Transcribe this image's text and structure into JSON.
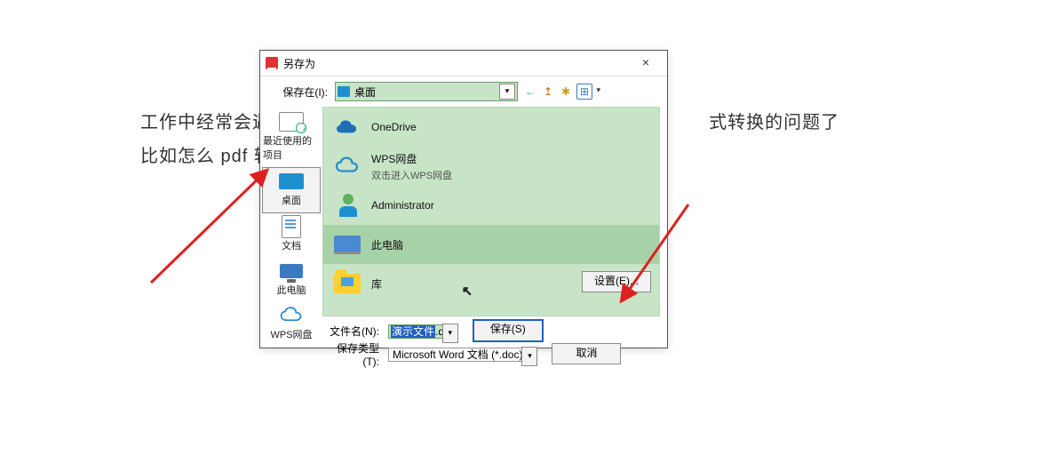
{
  "background": {
    "line1_left": "工作中经常会遇",
    "line1_right": "式转换的问题了",
    "line2": "比如怎么 pdf 转"
  },
  "dialog": {
    "title": "另存为",
    "close_symbol": "×",
    "save_in_label": "保存在(I):",
    "location_value": "桌面",
    "toolbar": {
      "back": "←",
      "up": "↥",
      "new_folder": "✱",
      "view": "⊞"
    },
    "sidebar": [
      {
        "key": "recent",
        "label": "最近使用的项目"
      },
      {
        "key": "desktop",
        "label": "桌面"
      },
      {
        "key": "docs",
        "label": "文档"
      },
      {
        "key": "pc",
        "label": "此电脑"
      },
      {
        "key": "wps",
        "label": "WPS网盘"
      }
    ],
    "files": [
      {
        "key": "onedrive",
        "name": "OneDrive",
        "sub": ""
      },
      {
        "key": "wpsdisk",
        "name": "WPS网盘",
        "sub": "双击进入WPS网盘"
      },
      {
        "key": "admin",
        "name": "Administrator",
        "sub": ""
      },
      {
        "key": "thispc",
        "name": "此电脑",
        "sub": ""
      },
      {
        "key": "lib",
        "name": "库",
        "sub": ""
      }
    ],
    "filename_label": "文件名(N):",
    "filename_value_selected": "演示文件",
    "filename_value_ext": ".doc",
    "filetype_label": "保存类型(T):",
    "filetype_value": "Microsoft Word 文档 (*.doc)",
    "buttons": {
      "settings": "设置(E)...",
      "save": "保存(S)",
      "cancel": "取消"
    },
    "cursor_glyph": "↖"
  }
}
